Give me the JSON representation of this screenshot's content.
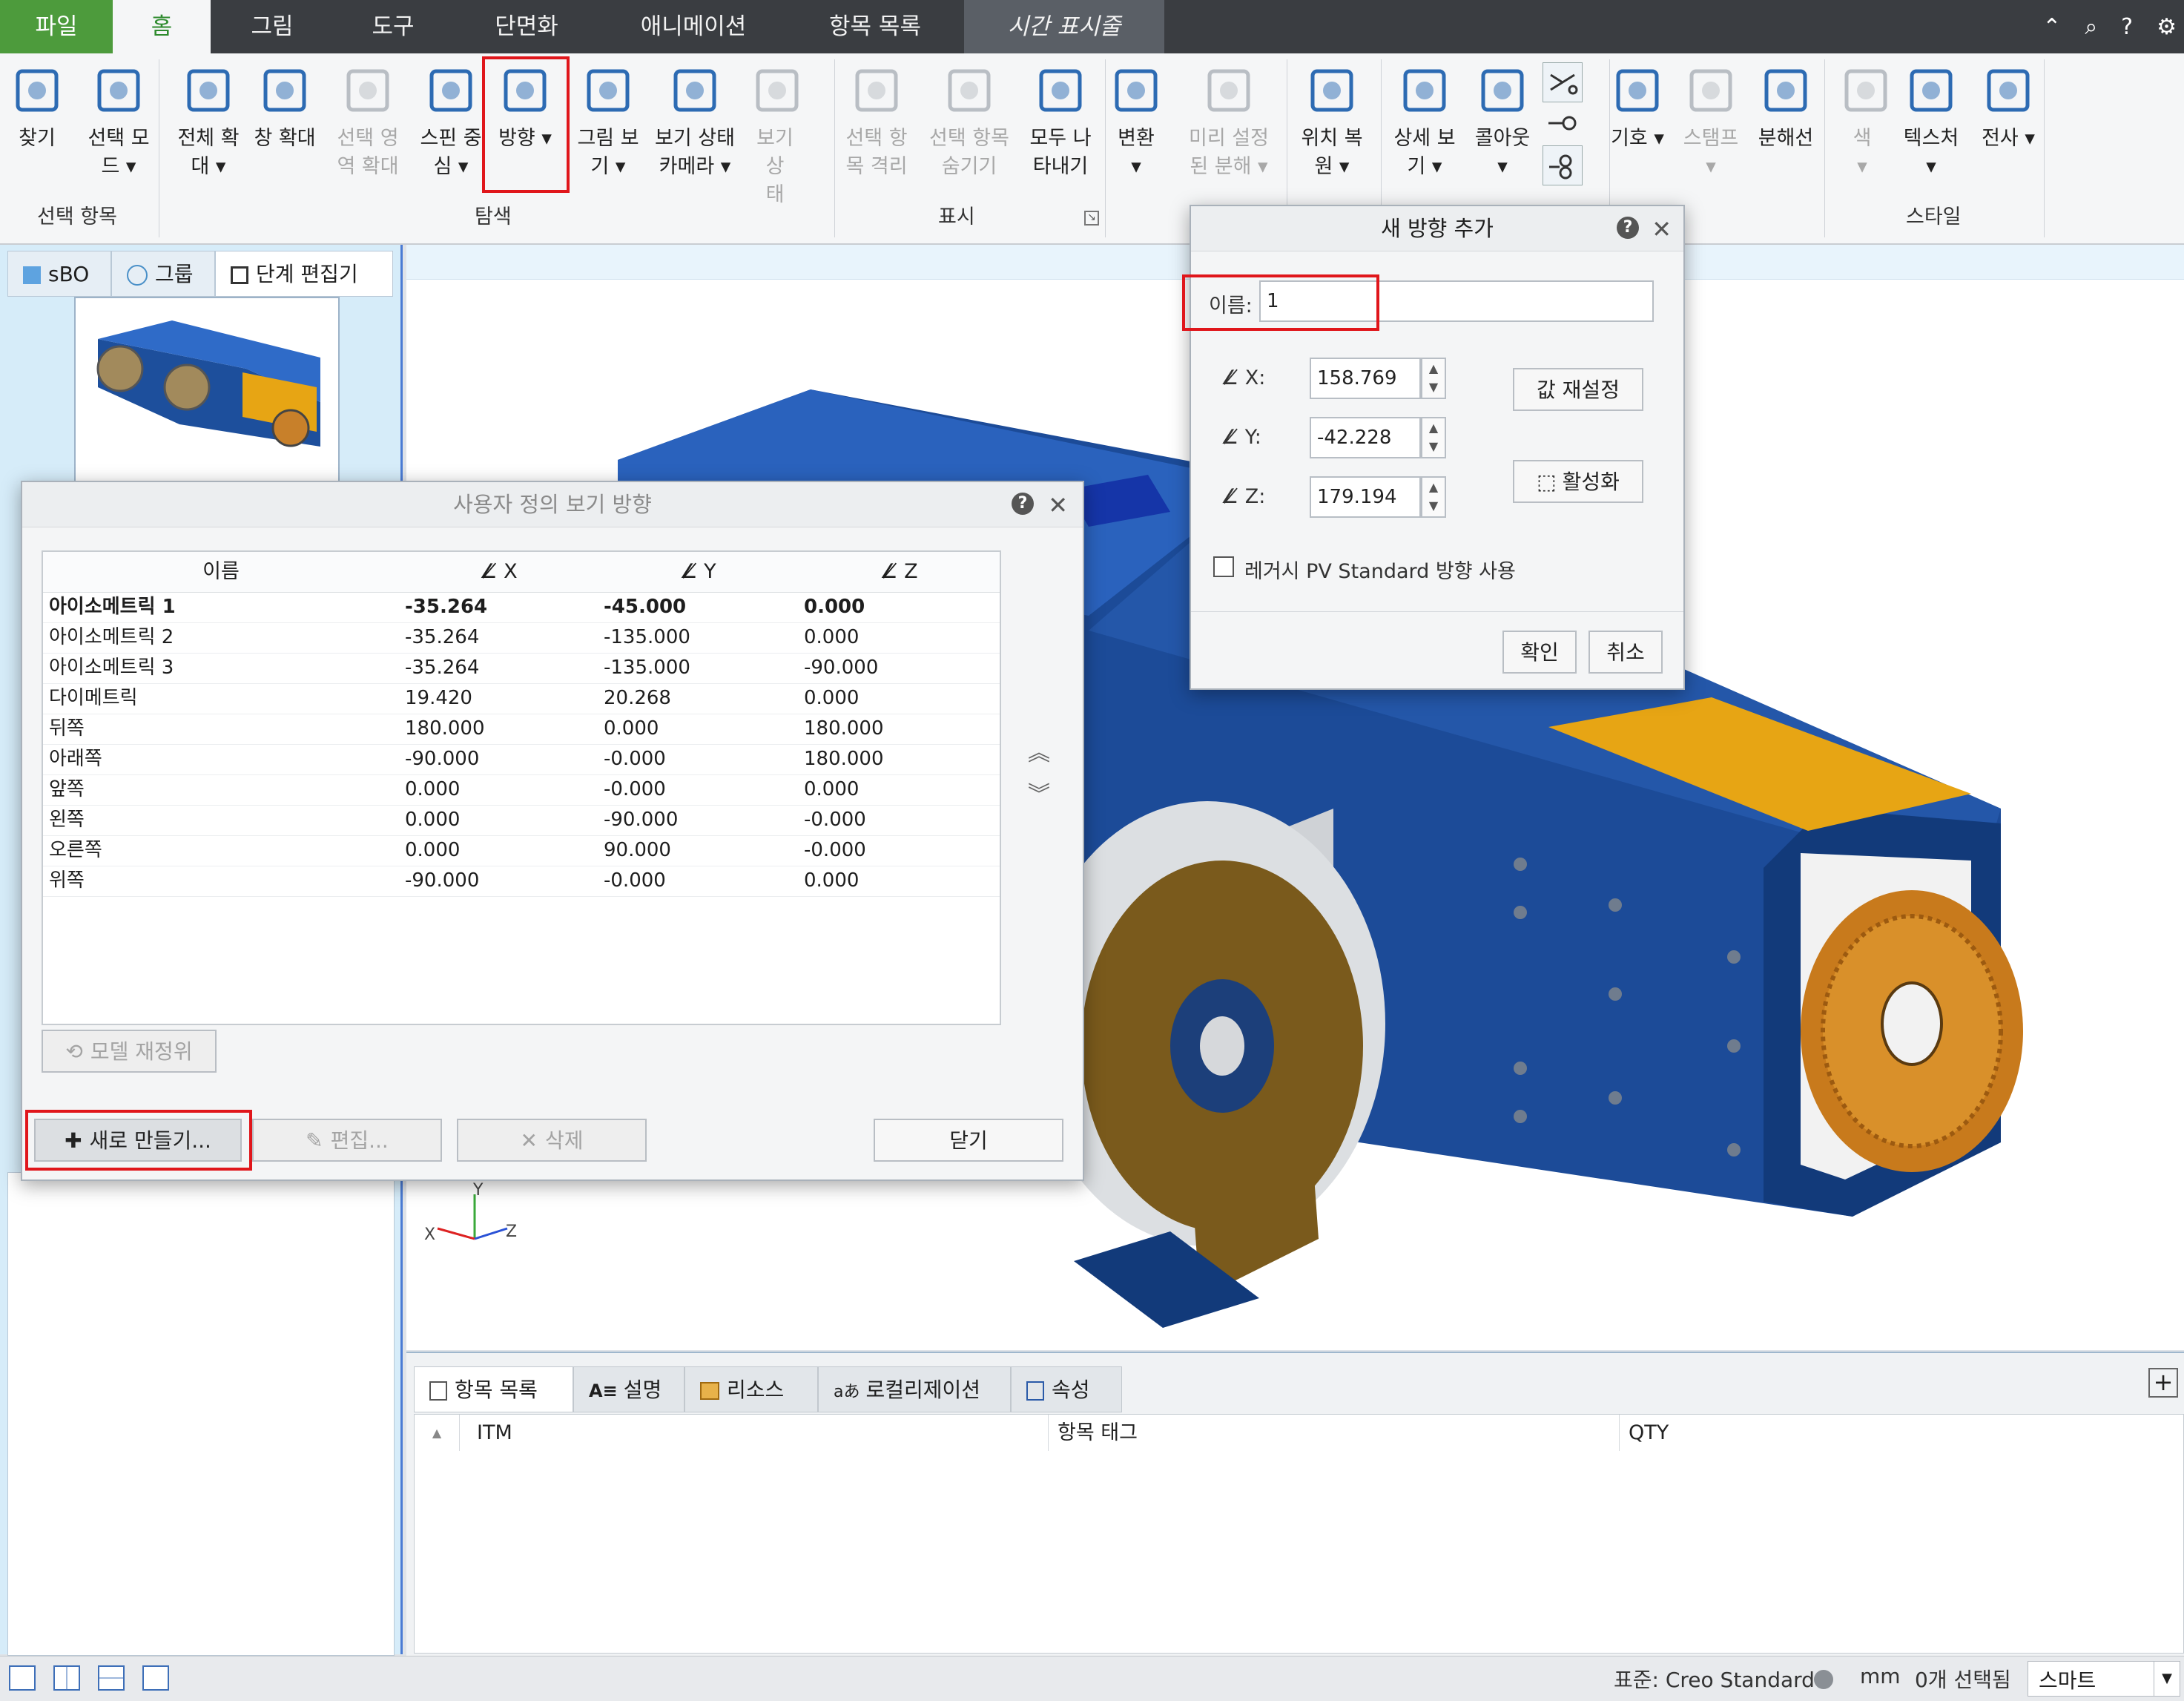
{
  "menu_tabs": [
    {
      "label": "파일"
    },
    {
      "label": "홈"
    },
    {
      "label": "그림"
    },
    {
      "label": "도구"
    },
    {
      "label": "단면화"
    },
    {
      "label": "애니메이션"
    },
    {
      "label": "항목 목록"
    },
    {
      "label": "시간 표시줄"
    }
  ],
  "ribbon": {
    "buttons": [
      {
        "label1": "찾기",
        "label2": "",
        "icon": "binoculars-icon"
      },
      {
        "label1": "선택 모",
        "label2": "드 ▾",
        "icon": "cursor-icon"
      },
      {
        "label1": "전체 확",
        "label2": "대 ▾",
        "icon": "zoom-all-icon"
      },
      {
        "label1": "창 확대",
        "label2": "",
        "icon": "window-zoom-icon"
      },
      {
        "label1": "선택 영",
        "label2": "역 확대",
        "icon": "zoom-selected-icon"
      },
      {
        "label1": "스핀 중",
        "label2": "심 ▾",
        "icon": "spin-center-icon"
      },
      {
        "label1": "방향 ▾",
        "label2": "",
        "icon": "orientation-icon"
      },
      {
        "label1": "그림 보",
        "label2": "기 ▾",
        "icon": "camera-icon"
      },
      {
        "label1": "보기 상태",
        "label2": "카메라 ▾",
        "icon": "view-state-camera-icon"
      },
      {
        "label1": "보기 상",
        "label2": "태",
        "icon": "view-state-icon"
      },
      {
        "label1": "선택 항",
        "label2": "목 격리",
        "icon": "isolate-icon"
      },
      {
        "label1": "선택 항목",
        "label2": "숨기기",
        "icon": "hide-selected-icon"
      },
      {
        "label1": "모두 나",
        "label2": "타내기",
        "icon": "show-all-icon"
      },
      {
        "label1": "변환",
        "label2": "▾",
        "icon": "transform-icon"
      },
      {
        "label1": "미리 설정",
        "label2": "된 분해 ▾",
        "icon": "preset-explode-icon"
      },
      {
        "label1": "위치 복",
        "label2": "원 ▾",
        "icon": "restore-position-icon"
      },
      {
        "label1": "상세 보",
        "label2": "기 ▾",
        "icon": "detail-view-icon"
      },
      {
        "label1": "콜아웃",
        "label2": "▾",
        "icon": "callout-icon"
      },
      {
        "label1": "기호 ▾",
        "label2": "",
        "icon": "symbol-icon"
      },
      {
        "label1": "스탬프",
        "label2": "▾",
        "icon": "stamp-icon"
      },
      {
        "label1": "분해선",
        "label2": "",
        "icon": "explode-line-icon"
      },
      {
        "label1": "색",
        "label2": "▾",
        "icon": "color-icon"
      },
      {
        "label1": "텍스처",
        "label2": "▾",
        "icon": "texture-icon"
      },
      {
        "label1": "전사 ▾",
        "label2": "",
        "icon": "decal-icon"
      }
    ],
    "groups": [
      "선택 항목",
      "탐색",
      "표시",
      "스타일"
    ]
  },
  "left_panel": {
    "tabs": [
      "sBO",
      "그룹",
      "단계 편집기"
    ]
  },
  "bottom_panel": {
    "tabs": [
      "항목 목록",
      "설명",
      "리소스",
      "로컬리제이션",
      "속성"
    ],
    "columns": [
      "ITM",
      "항목 태그",
      "QTY"
    ]
  },
  "status_bar": {
    "standard": "표준: Creo Standard",
    "units": "mm",
    "selected": "0개 선택됨",
    "mode": "스마트"
  },
  "view_dialog": {
    "title": "사용자 정의 보기 방향",
    "columns": [
      "이름",
      "X",
      "Y",
      "Z"
    ],
    "rows": [
      {
        "name": "아이소메트릭 1",
        "x": "-35.264",
        "y": "-45.000",
        "z": "0.000"
      },
      {
        "name": "아이소메트릭 2",
        "x": "-35.264",
        "y": "-135.000",
        "z": "0.000"
      },
      {
        "name": "아이소메트릭 3",
        "x": "-35.264",
        "y": "-135.000",
        "z": "-90.000"
      },
      {
        "name": "다이메트릭",
        "x": "19.420",
        "y": "20.268",
        "z": "0.000"
      },
      {
        "name": "뒤쪽",
        "x": "180.000",
        "y": "0.000",
        "z": "180.000"
      },
      {
        "name": "아래쪽",
        "x": "-90.000",
        "y": "-0.000",
        "z": "180.000"
      },
      {
        "name": "앞쪽",
        "x": "0.000",
        "y": "-0.000",
        "z": "0.000"
      },
      {
        "name": "왼쪽",
        "x": "0.000",
        "y": "-90.000",
        "z": "-0.000"
      },
      {
        "name": "오른쪽",
        "x": "0.000",
        "y": "90.000",
        "z": "-0.000"
      },
      {
        "name": "위쪽",
        "x": "-90.000",
        "y": "-0.000",
        "z": "0.000"
      }
    ],
    "reset_model_label": "모델 재정위",
    "new_label": "새로 만들기...",
    "edit_label": "편집...",
    "delete_label": "삭제",
    "close_label": "닫기"
  },
  "add_dialog": {
    "title": "새 방향 추가",
    "name_label": "이름:",
    "name_value": "1",
    "x_label": "X:",
    "x_value": "158.769",
    "y_label": "Y:",
    "y_value": "-42.228",
    "z_label": "Z:",
    "z_value": "179.194",
    "reset_label": "값 재설정",
    "activate_label": "활성화",
    "legacy_label": "레거시 PV Standard 방향 사용",
    "legacy_checked": false,
    "ok_label": "확인",
    "cancel_label": "취소"
  },
  "triad": {
    "x": "X",
    "y": "Y",
    "z": "Z"
  },
  "colors": {
    "accent": "#4d9b3c",
    "highlight": "#e0161b",
    "model_blue": "#1d4f9c",
    "model_yellow": "#e7a514"
  }
}
